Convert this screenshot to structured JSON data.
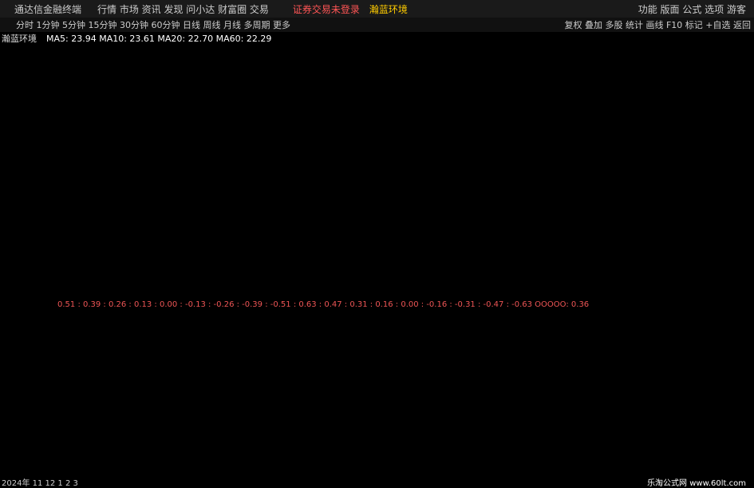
{
  "app_title": "通达信金融终端",
  "menu": [
    "行情",
    "市场",
    "资讯",
    "发现",
    "问小达",
    "财富圈",
    "交易"
  ],
  "status_text": "证券交易未登录",
  "stock_name": "瀚蓝环境",
  "right_menu": [
    "功能",
    "版面",
    "公式",
    "选项",
    "游客"
  ],
  "periods": [
    "分时",
    "1分钟",
    "5分钟",
    "15分钟",
    "30分钟",
    "60分钟",
    "日线",
    "周线",
    "月线",
    "多周期",
    "更多"
  ],
  "toolbar": [
    "复权",
    "叠加",
    "多股",
    "统计",
    "画线",
    "F10",
    "标记",
    "+自选",
    "返回"
  ],
  "ma_labels": [
    "MA5: 23.94",
    "MA10: 23.61",
    "MA20: 22.70",
    "MA60: 22.29"
  ],
  "indicator_values": "0.51 : 0.39 : 0.26 : 0.13 : 0.00 : -0.13 : -0.26 : -0.39 : -0.51 : 0.63 : 0.47 : 0.31 : 0.16 : 0.00 : -0.16 : -0.31 : -0.47 : -0.63    OOOOO: 0.36",
  "date_labels": [
    "2024年",
    "11",
    "12",
    "1",
    "2",
    "3"
  ],
  "watermark": "乐淘公式网 www.60lt.com"
}
